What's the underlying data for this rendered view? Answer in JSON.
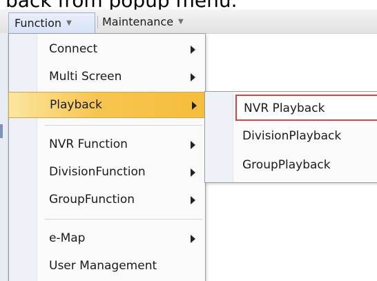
{
  "caption": "back  from popup menu.",
  "menubar": {
    "function_label": "Function",
    "maintenance_label": "Maintenance"
  },
  "function_menu": {
    "items": [
      {
        "label": "Connect",
        "has_submenu": true
      },
      {
        "label": "Multi Screen",
        "has_submenu": true
      },
      {
        "label": "Playback",
        "has_submenu": true,
        "highlighted": true
      },
      {
        "label": "NVR Function",
        "has_submenu": true
      },
      {
        "label": "DivisionFunction",
        "has_submenu": true
      },
      {
        "label": "GroupFunction",
        "has_submenu": true
      },
      {
        "label": "e-Map",
        "has_submenu": true
      },
      {
        "label": "User Management",
        "has_submenu": false
      }
    ]
  },
  "playback_submenu": {
    "items": [
      {
        "label": "NVR Playback",
        "selected": true
      },
      {
        "label": "DivisionPlayback"
      },
      {
        "label": "GroupPlayback"
      }
    ]
  },
  "colors": {
    "highlight": "#f7c54f",
    "selection_border": "#e04040"
  }
}
